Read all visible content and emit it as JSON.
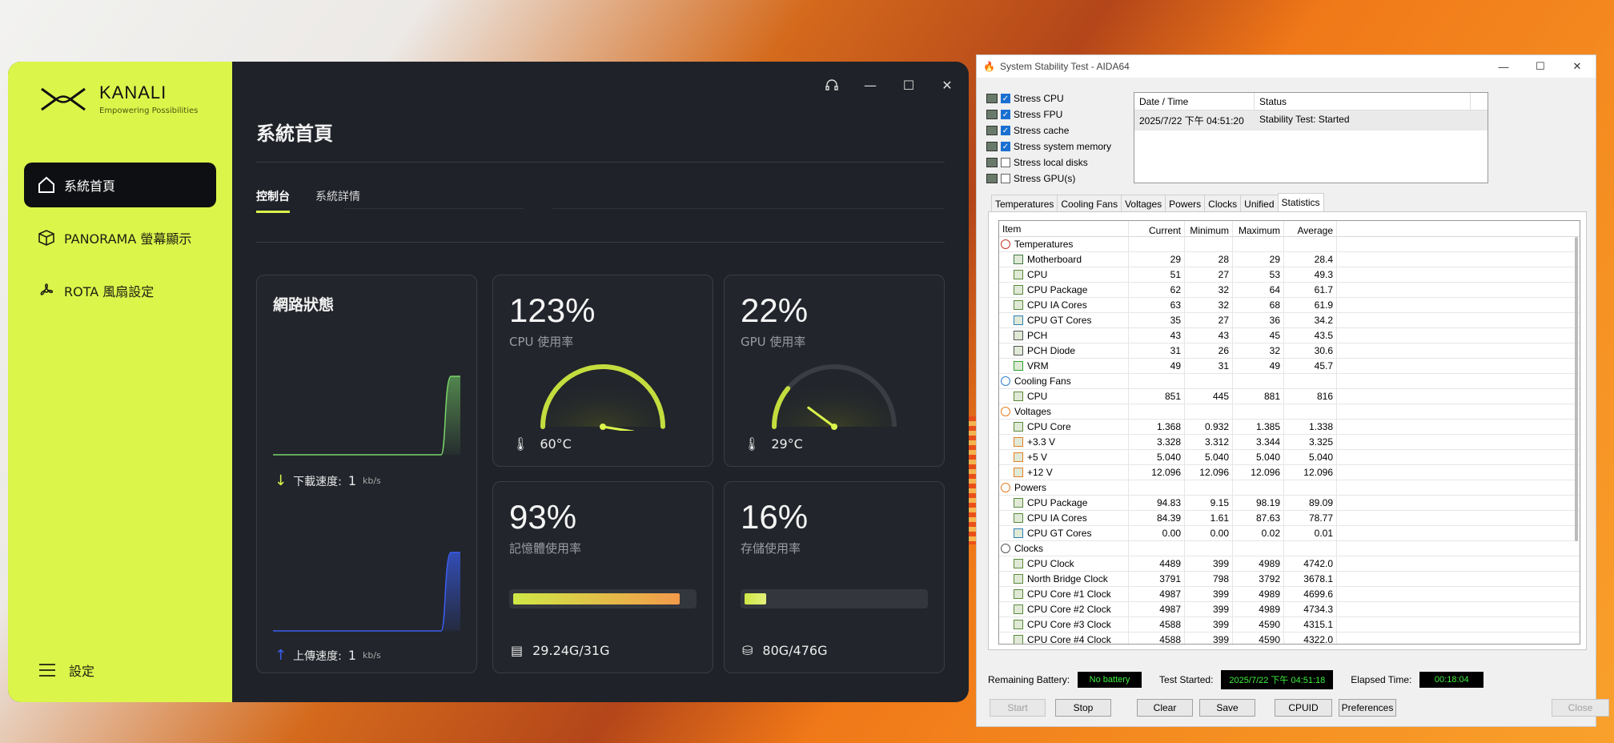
{
  "kanali": {
    "brand": {
      "name": "KANALI",
      "tagline": "Empowering Possibilities"
    },
    "nav": [
      {
        "label": "系統首頁",
        "icon": "home-icon"
      },
      {
        "label": "PANORAMA 螢幕顯示",
        "icon": "cube-icon"
      },
      {
        "label": "ROTA 風扇設定",
        "icon": "fan-icon"
      }
    ],
    "settings_label": "設定",
    "page_title": "系統首頁",
    "tabs": [
      {
        "label": "控制台",
        "active": true
      },
      {
        "label": "系統詳情",
        "active": false
      }
    ],
    "network": {
      "title": "網路狀態",
      "download_label": "下載速度:",
      "download_value": "1",
      "download_unit": "kb/s",
      "upload_label": "上傳速度:",
      "upload_value": "1",
      "upload_unit": "kb/s"
    },
    "cpu": {
      "value": "123%",
      "label": "CPU 使用率",
      "temp": "60°C",
      "gauge_fraction": 1.0
    },
    "gpu": {
      "value": "22%",
      "label": "GPU 使用率",
      "temp": "29°C",
      "gauge_fraction": 0.22
    },
    "memory": {
      "value": "93%",
      "label": "記憶體使用率",
      "detail": "29.24G/31G",
      "fill": 0.93
    },
    "storage": {
      "value": "16%",
      "label": "存儲使用率",
      "detail": "80G/476G",
      "fill": 0.16
    },
    "colors": {
      "accent": "#dcf54b",
      "download": "#79d46a",
      "upload": "#3a5ef0"
    }
  },
  "aida": {
    "window_title": "System Stability Test - AIDA64",
    "stress": [
      {
        "label": "Stress CPU",
        "checked": true
      },
      {
        "label": "Stress FPU",
        "checked": true
      },
      {
        "label": "Stress cache",
        "checked": true
      },
      {
        "label": "Stress system memory",
        "checked": true
      },
      {
        "label": "Stress local disks",
        "checked": false
      },
      {
        "label": "Stress GPU(s)",
        "checked": false
      }
    ],
    "log": {
      "col_date": "Date / Time",
      "col_status": "Status",
      "rows": [
        {
          "date": "2025/7/22 下午 04:51:20",
          "status": "Stability Test: Started"
        }
      ]
    },
    "tabs": [
      "Temperatures",
      "Cooling Fans",
      "Voltages",
      "Powers",
      "Clocks",
      "Unified",
      "Statistics"
    ],
    "active_tab": "Statistics",
    "columns": [
      "Item",
      "Current",
      "Minimum",
      "Maximum",
      "Average"
    ],
    "rows": [
      {
        "type": "group",
        "item": "Temperatures",
        "icon": "thermometer-icon"
      },
      {
        "item": "Motherboard",
        "icon": "motherboard-icon",
        "cur": "29",
        "min": "28",
        "max": "29",
        "avg": "28.4"
      },
      {
        "item": "CPU",
        "icon": "cpu-icon",
        "cur": "51",
        "min": "27",
        "max": "53",
        "avg": "49.3"
      },
      {
        "item": "CPU Package",
        "icon": "cpu-icon",
        "cur": "62",
        "min": "32",
        "max": "64",
        "avg": "61.7"
      },
      {
        "item": "CPU IA Cores",
        "icon": "cpu-icon",
        "cur": "63",
        "min": "32",
        "max": "68",
        "avg": "61.9"
      },
      {
        "item": "CPU GT Cores",
        "icon": "monitor-icon",
        "cur": "35",
        "min": "27",
        "max": "36",
        "avg": "34.2"
      },
      {
        "item": "PCH",
        "icon": "chip-icon",
        "cur": "43",
        "min": "43",
        "max": "45",
        "avg": "43.5"
      },
      {
        "item": "PCH Diode",
        "icon": "chip-icon",
        "cur": "31",
        "min": "26",
        "max": "32",
        "avg": "30.6"
      },
      {
        "item": "VRM",
        "icon": "vrm-icon",
        "cur": "49",
        "min": "31",
        "max": "49",
        "avg": "45.7"
      },
      {
        "type": "group",
        "item": "Cooling Fans",
        "icon": "fan-icon"
      },
      {
        "item": "CPU",
        "icon": "cpu-icon",
        "cur": "851",
        "min": "445",
        "max": "881",
        "avg": "816"
      },
      {
        "type": "group",
        "item": "Voltages",
        "icon": "voltage-icon"
      },
      {
        "item": "CPU Core",
        "icon": "cpu-icon",
        "cur": "1.368",
        "min": "0.932",
        "max": "1.385",
        "avg": "1.338"
      },
      {
        "item": "+3.3 V",
        "icon": "voltage-icon",
        "cur": "3.328",
        "min": "3.312",
        "max": "3.344",
        "avg": "3.325"
      },
      {
        "item": "+5 V",
        "icon": "voltage-icon",
        "cur": "5.040",
        "min": "5.040",
        "max": "5.040",
        "avg": "5.040"
      },
      {
        "item": "+12 V",
        "icon": "voltage-icon",
        "cur": "12.096",
        "min": "12.096",
        "max": "12.096",
        "avg": "12.096"
      },
      {
        "type": "group",
        "item": "Powers",
        "icon": "voltage-icon"
      },
      {
        "item": "CPU Package",
        "icon": "cpu-icon",
        "cur": "94.83",
        "min": "9.15",
        "max": "98.19",
        "avg": "89.09"
      },
      {
        "item": "CPU IA Cores",
        "icon": "cpu-icon",
        "cur": "84.39",
        "min": "1.61",
        "max": "87.63",
        "avg": "78.77"
      },
      {
        "item": "CPU GT Cores",
        "icon": "monitor-icon",
        "cur": "0.00",
        "min": "0.00",
        "max": "0.02",
        "avg": "0.01"
      },
      {
        "type": "group",
        "item": "Clocks",
        "icon": "chip-icon"
      },
      {
        "item": "CPU Clock",
        "icon": "cpu-icon",
        "cur": "4489",
        "min": "399",
        "max": "4989",
        "avg": "4742.0"
      },
      {
        "item": "North Bridge Clock",
        "icon": "cpu-icon",
        "cur": "3791",
        "min": "798",
        "max": "3792",
        "avg": "3678.1"
      },
      {
        "item": "CPU Core #1 Clock",
        "icon": "cpu-icon",
        "cur": "4987",
        "min": "399",
        "max": "4989",
        "avg": "4699.6"
      },
      {
        "item": "CPU Core #2 Clock",
        "icon": "cpu-icon",
        "cur": "4987",
        "min": "399",
        "max": "4989",
        "avg": "4734.3"
      },
      {
        "item": "CPU Core #3 Clock",
        "icon": "cpu-icon",
        "cur": "4588",
        "min": "399",
        "max": "4590",
        "avg": "4315.1"
      },
      {
        "item": "CPU Core #4 Clock",
        "icon": "cpu-icon",
        "cur": "4588",
        "min": "399",
        "max": "4590",
        "avg": "4322.0"
      }
    ],
    "footer": {
      "battery_label": "Remaining Battery:",
      "battery_value": "No battery",
      "started_label": "Test Started:",
      "started_value": "2025/7/22 下午 04:51:18",
      "elapsed_label": "Elapsed Time:",
      "elapsed_value": "00:18:04"
    },
    "buttons": {
      "start": "Start",
      "stop": "Stop",
      "clear": "Clear",
      "save": "Save",
      "cpuid": "CPUID",
      "preferences": "Preferences",
      "close": "Close"
    }
  }
}
